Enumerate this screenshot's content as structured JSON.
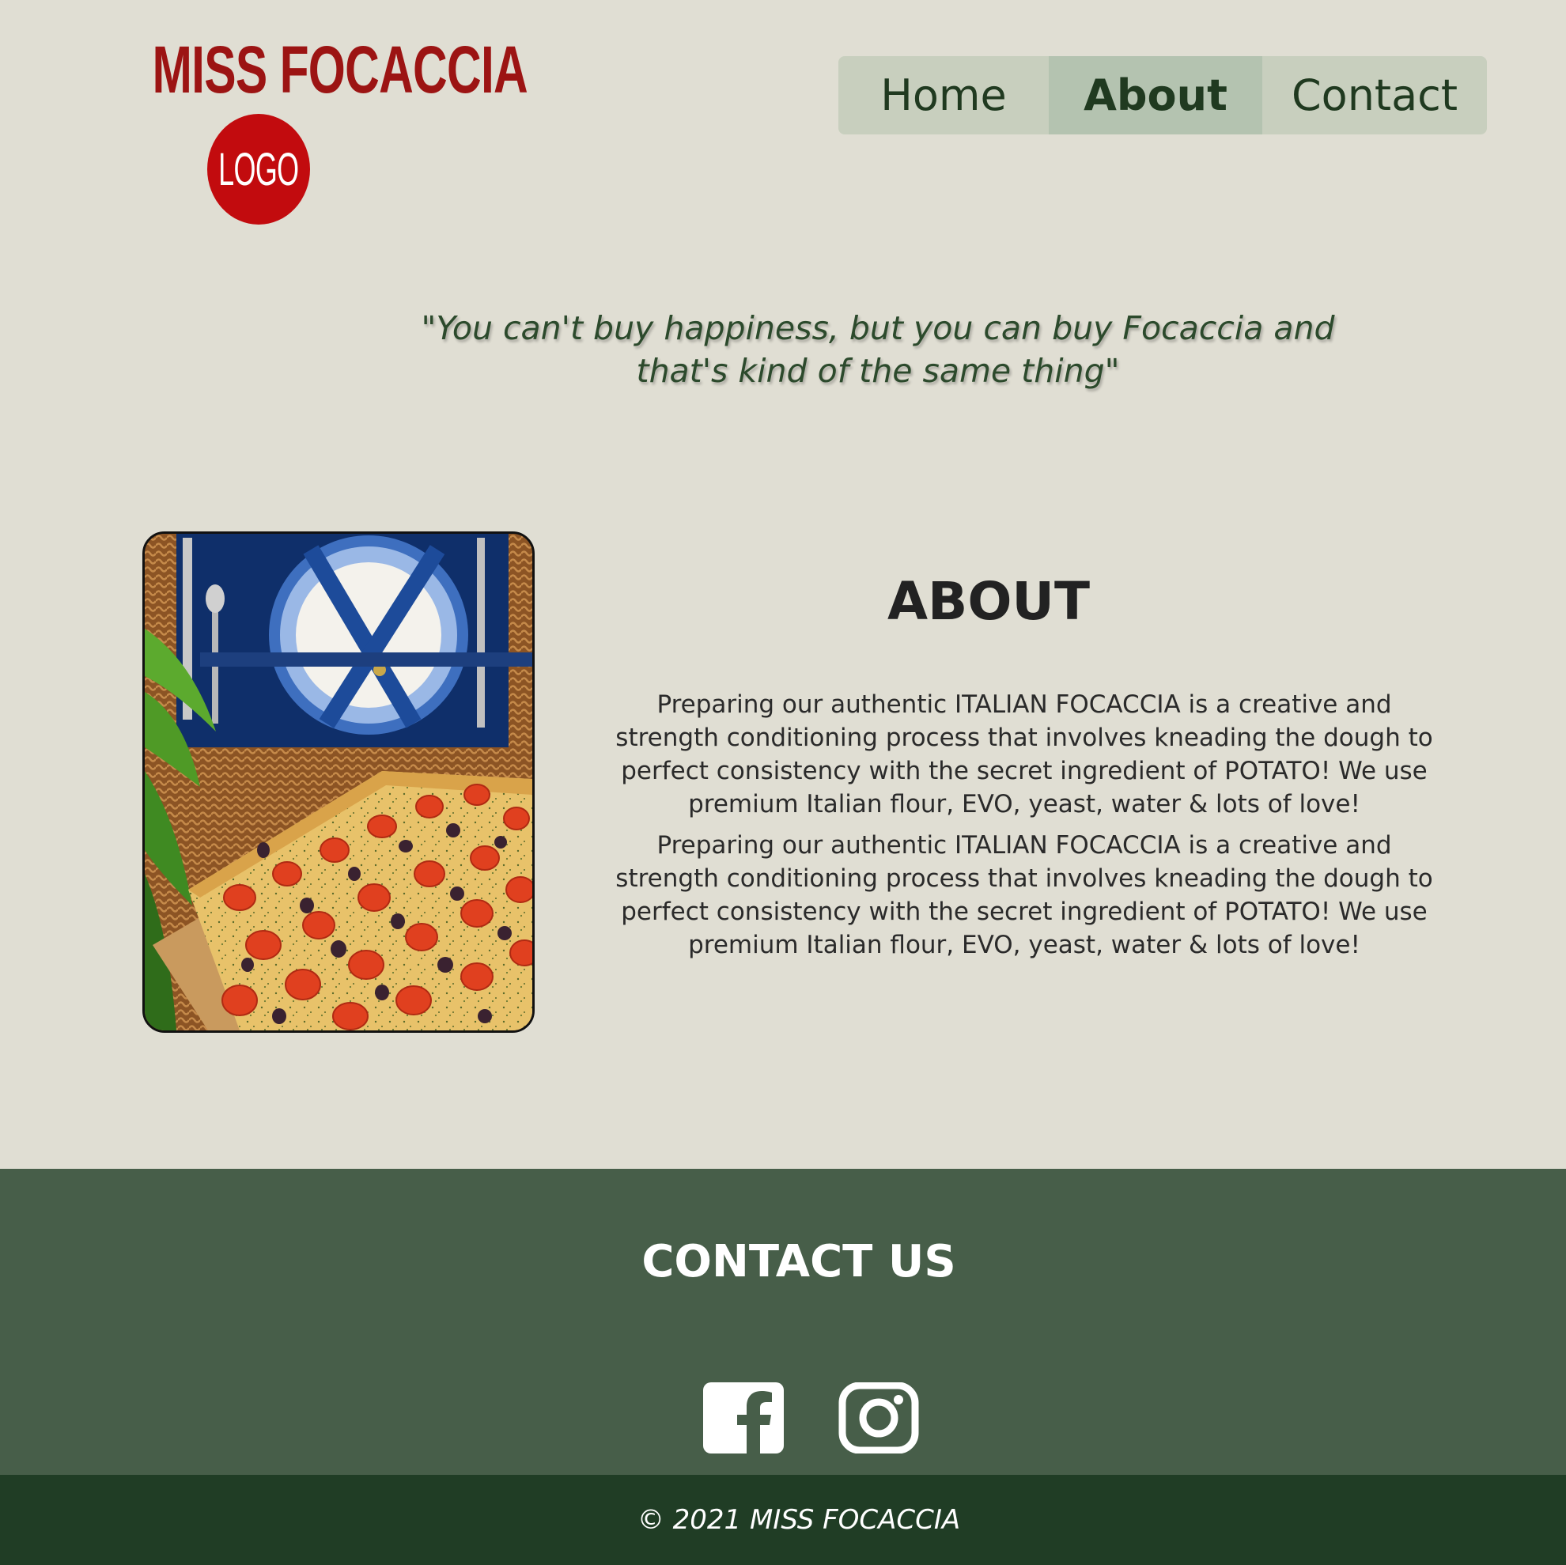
{
  "header": {
    "brand_name": "MISS FOCACCIA",
    "logo_text": "LOGO"
  },
  "nav": {
    "items": [
      {
        "label": "Home",
        "active": false
      },
      {
        "label": "About",
        "active": true
      },
      {
        "label": "Contact",
        "active": false
      }
    ]
  },
  "quote": "\"You can't buy happiness, but you can buy Focaccia and that's kind of the same thing\"",
  "about": {
    "title": "ABOUT",
    "paragraphs": [
      "Preparing our authentic ITALIAN FOCACCIA is a creative and strength conditioning process that involves kneading the dough to perfect consistency with the secret ingredient of POTATO! We use premium Italian flour, EVO, yeast, water & lots of love!",
      "Preparing our authentic ITALIAN FOCACCIA is a creative and strength conditioning process that involves kneading the dough to perfect consistency with the secret ingredient of POTATO! We use premium Italian flour, EVO, yeast, water & lots of love!"
    ],
    "image": "focaccia-picnic-basket-photo"
  },
  "contact": {
    "title": "CONTACT US",
    "socials": [
      {
        "name": "facebook-icon"
      },
      {
        "name": "instagram-icon"
      }
    ]
  },
  "footer": {
    "copyright": "© 2021 MISS FOCACCIA"
  },
  "colors": {
    "page_bg": "#e0ded3",
    "brand_red": "#9c1413",
    "logo_red": "#c20b0e",
    "nav_bg": "#c8cfbe",
    "nav_active_bg": "#b4c3b0",
    "nav_text": "#203a20",
    "contact_bg": "#475e49",
    "footer_bg": "#203d25"
  }
}
